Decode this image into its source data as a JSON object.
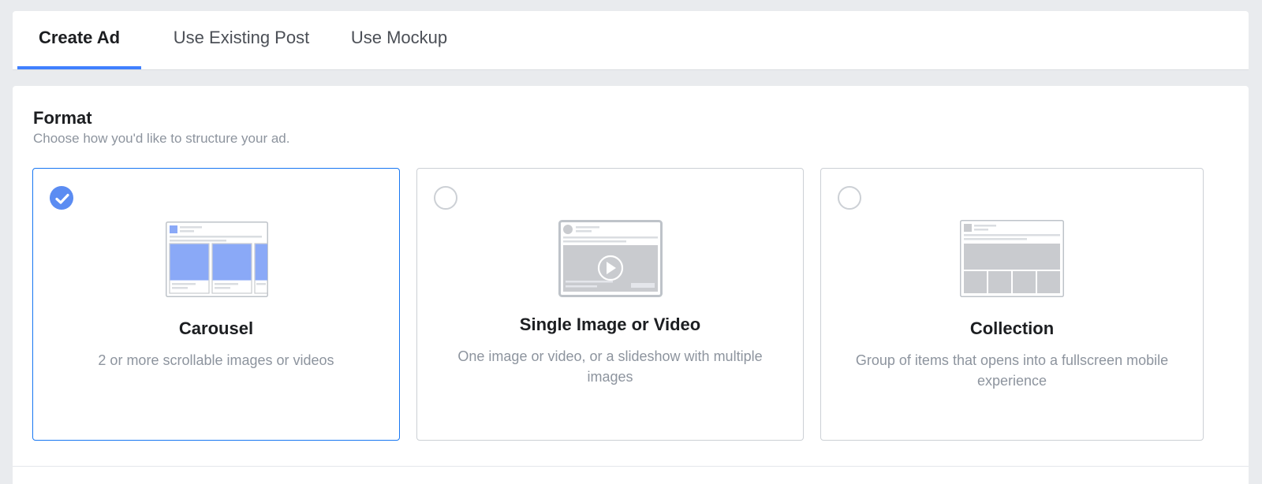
{
  "tabs": [
    {
      "label": "Create Ad",
      "active": true
    },
    {
      "label": "Use Existing Post",
      "active": false
    },
    {
      "label": "Use Mockup",
      "active": false
    }
  ],
  "format": {
    "title": "Format",
    "subtitle": "Choose how you'd like to structure your ad.",
    "options": [
      {
        "title": "Carousel",
        "description": "2 or more scrollable images or videos",
        "selected": true,
        "icon": "carousel-preview-icon"
      },
      {
        "title": "Single Image or Video",
        "description": "One image or video, or a slideshow with multiple images",
        "selected": false,
        "icon": "single-image-video-preview-icon"
      },
      {
        "title": "Collection",
        "description": "Group of items that opens into a fullscreen mobile experience",
        "selected": false,
        "icon": "collection-preview-icon"
      }
    ]
  },
  "colors": {
    "accent": "#4080ff",
    "selected_border": "#1877f2",
    "check_fill": "#5b8cf2",
    "carousel_image": "#8aa9f7",
    "placeholder_gray": "#c9cbcf"
  }
}
